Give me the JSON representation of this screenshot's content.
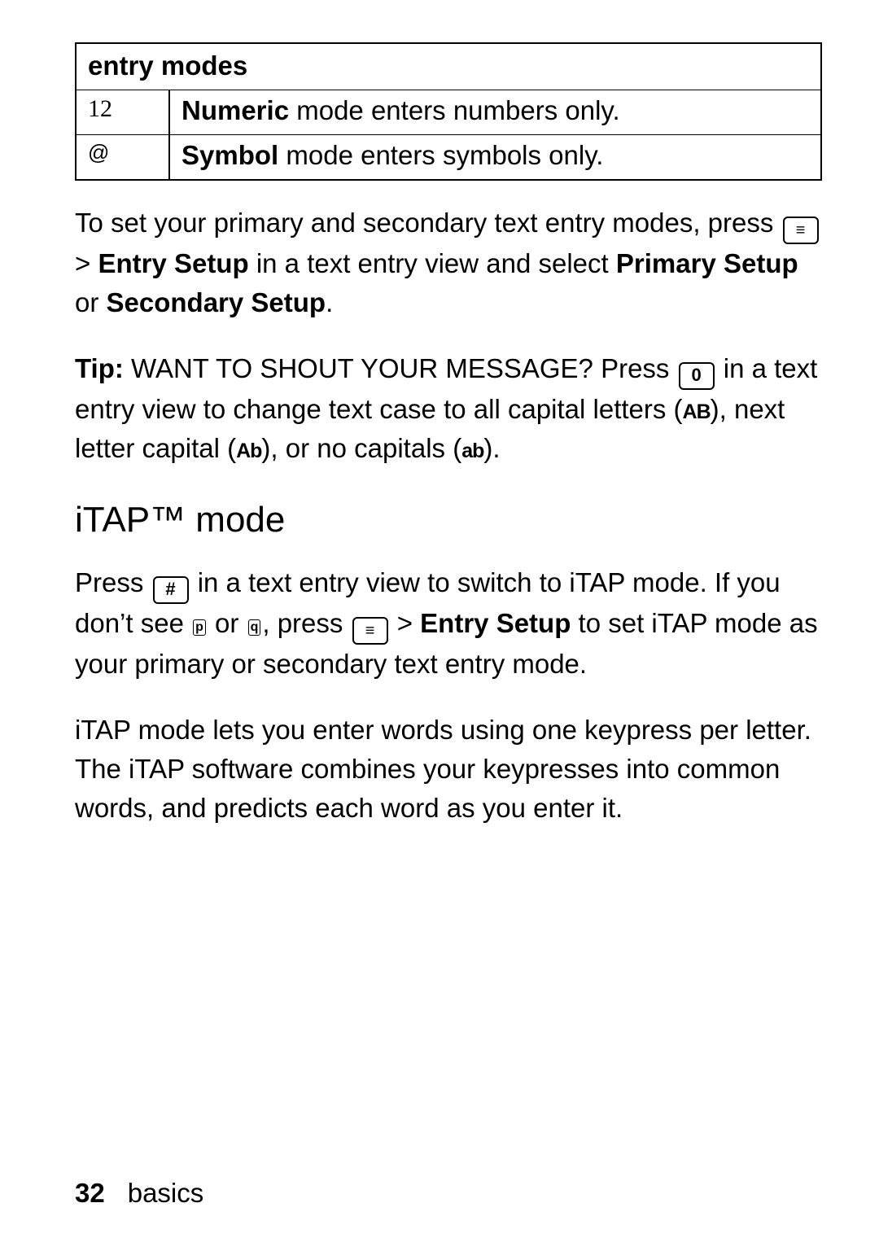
{
  "table": {
    "header": "entry modes",
    "rows": [
      {
        "icon": "12",
        "bold": "Numeric",
        "rest": " mode enters numbers only."
      },
      {
        "icon": "@",
        "bold": "Symbol",
        "rest": " mode enters symbols only."
      }
    ]
  },
  "para1": {
    "pre": "To set your primary and secondary text entry modes, press ",
    "gt1": " > ",
    "entry_setup": "Entry Setup",
    "mid": " in a text entry view and select ",
    "primary": "Primary Setup",
    "or": " or ",
    "secondary": "Secondary Setup",
    "dot": "."
  },
  "tip": {
    "label": "Tip: ",
    "shout": "WANT TO SHOUT YOUR MESSAGE? Press ",
    "after0": " in a text entry view to change text case to all capital letters (",
    "AB": "AB",
    "next": "), next letter capital (",
    "Ab": "Ab",
    "noc": "), or no capitals (",
    "ab": "ab",
    "end": ")."
  },
  "heading": "iTAP™ mode",
  "para2": {
    "press": "Press ",
    "after_hash": " in a text entry view to switch to iTAP mode. If you don’t see ",
    "icon1": "p",
    "or": " or ",
    "icon2": "q",
    "press2": ", press ",
    "gt": " > ",
    "entry_setup": "Entry Setup",
    "tail": " to set iTAP mode as your primary or secondary text entry mode."
  },
  "para3": "iTAP mode lets you enter words using one keypress per letter. The iTAP software combines your keypresses into common words, and predicts each word as you enter it.",
  "footer": {
    "page": "32",
    "section": "basics"
  }
}
